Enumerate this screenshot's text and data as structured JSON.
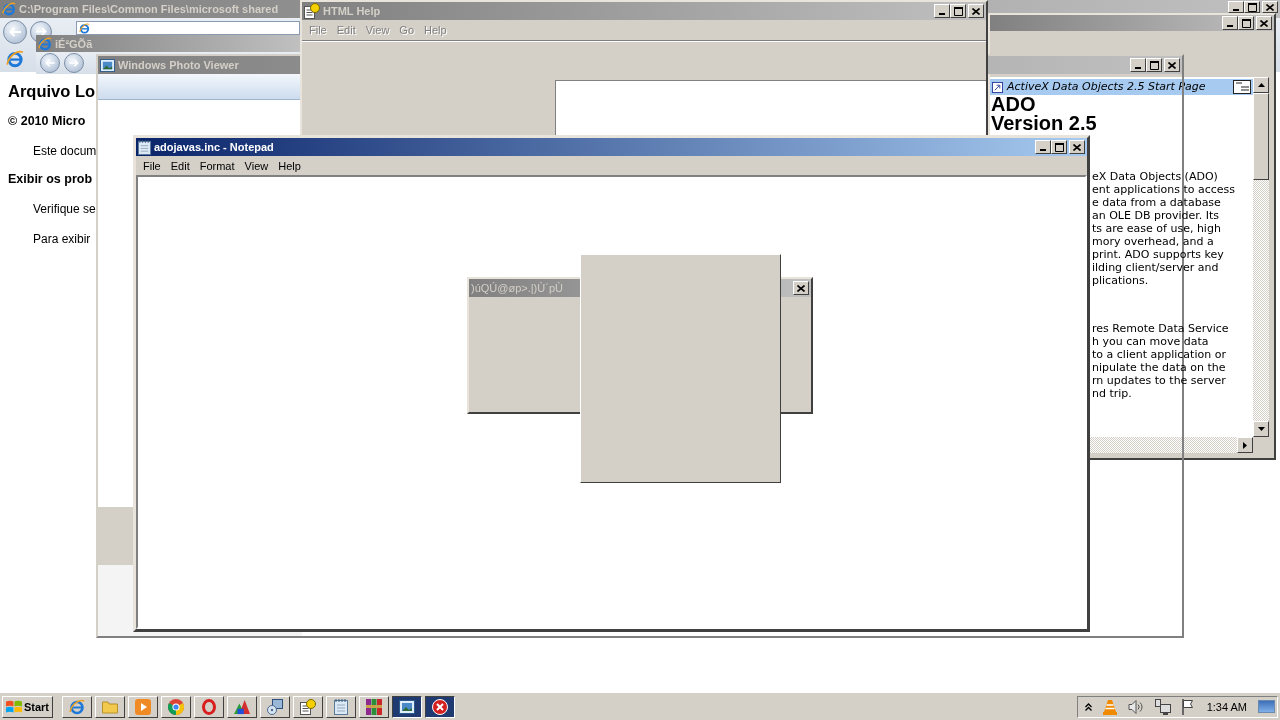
{
  "browser_window": {
    "title": "C:\\Program Files\\Common Files\\microsoft shared",
    "active": false,
    "page": [
      {
        "kind": "heading",
        "text": "Arquivo Lo"
      },
      {
        "kind": "bold",
        "text": "© 2010 Micro"
      },
      {
        "kind": "indent",
        "text": "Este docum"
      },
      {
        "kind": "bold",
        "text": "Exibir os prob"
      },
      {
        "kind": "indent",
        "text": "Verifique se"
      },
      {
        "kind": "indent",
        "text": "Para exibir"
      }
    ]
  },
  "browser_window_2": {
    "title": "iÉ²GÕã",
    "active": false
  },
  "help_viewer": {
    "active": false,
    "topic_title": "ActiveX Data Objects 2.5 Start Page",
    "headings": [
      "ADO",
      "Version 2.5"
    ],
    "paragraphs": [
      [
        "eX Data Objects (ADO)",
        "ent applications to access",
        "e data from a database",
        "an OLE DB provider. Its",
        "ts are ease of use, high",
        "mory overhead, and a",
        "print. ADO supports key",
        "ilding client/server and",
        "plications."
      ],
      [
        "res Remote Data Service",
        "h you can move data",
        "to a client application or",
        "nipulate the data on the",
        "rn updates to the server",
        "nd trip."
      ]
    ]
  },
  "photo_viewer": {
    "title": "Windows Photo Viewer",
    "active": false
  },
  "html_help": {
    "title": "HTML Help",
    "active": false,
    "menu": [
      {
        "label": "File",
        "disabled": true
      },
      {
        "label": "Edit",
        "disabled": true
      },
      {
        "label": "View",
        "disabled": true
      },
      {
        "label": "Go",
        "disabled": true
      },
      {
        "label": "Help",
        "disabled": true
      }
    ]
  },
  "notepad": {
    "title": "adojavas.inc - Notepad",
    "active": true,
    "menu": [
      "File",
      "Edit",
      "Format",
      "View",
      "Help"
    ]
  },
  "dialog": {
    "title": ")úQÚ@øp>.|)Ù´pÙ",
    "active": false
  },
  "taskbar": {
    "start": "Start",
    "buttons": [
      {
        "kind": "browser",
        "highlighted": false
      },
      {
        "kind": "folder",
        "highlighted": false
      },
      {
        "kind": "player",
        "highlighted": false
      },
      {
        "kind": "ring",
        "highlighted": false
      },
      {
        "kind": "oval",
        "highlighted": false
      },
      {
        "kind": "shapes",
        "highlighted": false
      },
      {
        "kind": "installer",
        "highlighted": false
      },
      {
        "kind": "help",
        "highlighted": false
      },
      {
        "kind": "notepad",
        "highlighted": false
      },
      {
        "kind": "books",
        "highlighted": false
      },
      {
        "kind": "picture",
        "highlighted": true
      },
      {
        "kind": "error",
        "highlighted": true
      }
    ],
    "clock": "1:34 AM"
  }
}
